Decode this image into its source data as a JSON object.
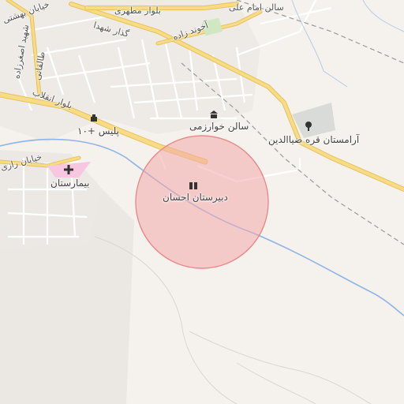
{
  "map": {
    "highlight_color": "#f2a9a9",
    "river_color": "#8fb4e6",
    "main_road_color": "#f3cf6a",
    "streets": {
      "khiaban_behshti": "خیابان بهشتی",
      "bolvar_motahari": "بلوار مطهری",
      "salon_imam_ali": "سالن امام علی",
      "gozar_shohada": "گذار شهدا",
      "akhond_zadeh": "آخوند زاده",
      "shahid_asgharzadeh": "شهید اصغرزاده",
      "taleghani": "طالقانی",
      "bolvar_enghelab": "بلوار انقلاب",
      "khiaban_razi": "خیابان رازی"
    },
    "pois": {
      "police": "پلیس +۱۰",
      "salon_kharazmi": "سالن خوارزمی",
      "cemetery": "آرامستان قره ضیاالدین",
      "hospital": "بیمارستان",
      "school": "دبیرستان احسان"
    },
    "icons": {
      "police": "police-icon",
      "salon": "hall-icon",
      "cemetery": "cemetery-tree-icon",
      "hospital": "hospital-cross-icon",
      "school": "school-icon"
    }
  }
}
